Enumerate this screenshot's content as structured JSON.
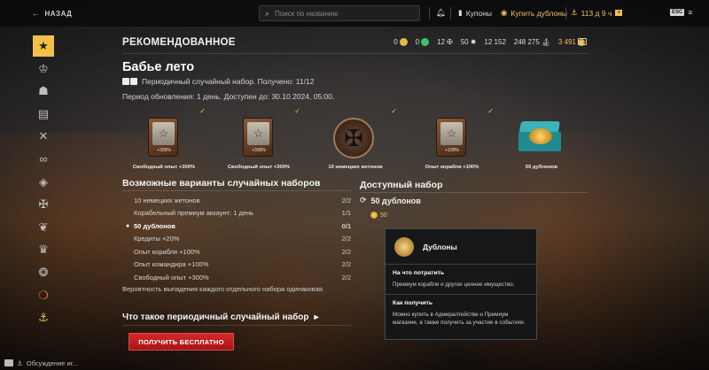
{
  "topbar": {
    "back_label": "НАЗАД",
    "search_placeholder": "Поиск по названию",
    "coupons_label": "Купоны",
    "buy_gold_label": "Купить дублоны",
    "premium_time": "113 д 9 ч",
    "esc_label": "ESC"
  },
  "sidebar": {
    "items": [
      "featured",
      "clan",
      "commander",
      "camouflage",
      "tools",
      "signals",
      "flags",
      "ensign",
      "eagle",
      "emblem",
      "medal",
      "chest",
      "anchor"
    ]
  },
  "header": {
    "title": "РЕКОМЕНДОВАННОЕ",
    "currencies": [
      {
        "value": "0",
        "color": "#e8b64a"
      },
      {
        "value": "0",
        "color": "#39c36b"
      },
      {
        "value": "12",
        "color": "#cfcfcf"
      },
      {
        "value": "50",
        "color": "#d8d8d8"
      },
      {
        "value": "12 152",
        "color": "#d8d8d8"
      },
      {
        "value": "248 275",
        "color": "#d8d8d8"
      },
      {
        "value": "3 491",
        "color": "#f0c060"
      }
    ]
  },
  "bundle": {
    "title": "Бабье лето",
    "subtitle": "Периодичный случайный набор. Получено: 11/12",
    "period": "Период обновления: 1 день. Доступен до: 30.10.2024, 05:00."
  },
  "rewards": [
    {
      "label": "Свободный опыт +300%",
      "pct": "+300%",
      "kind": "card"
    },
    {
      "label": "Свободный опыт +300%",
      "pct": "+300%",
      "kind": "card"
    },
    {
      "label": "10 немецких жетонов",
      "pct": "",
      "kind": "medal"
    },
    {
      "label": "Опыт корабля +100%",
      "pct": "+100%",
      "kind": "card"
    },
    {
      "label": "50 дублонов",
      "pct": "",
      "kind": "chest"
    }
  ],
  "possible": {
    "title": "Возможные варианты случайных наборов",
    "rows": [
      {
        "label": "10 немецких жетонов",
        "count": "2/2"
      },
      {
        "label": "Корабельный премиум аккаунт: 1 день",
        "count": "1/1"
      },
      {
        "label": "50 дублонов",
        "count": "0/1"
      },
      {
        "label": "Кредиты +20%",
        "count": "2/2"
      },
      {
        "label": "Опыт корабля +100%",
        "count": "2/2"
      },
      {
        "label": "Опыт командира +100%",
        "count": "2/2"
      },
      {
        "label": "Свободный опыт +300%",
        "count": "2/2"
      }
    ],
    "probability_note": "Вероятность выпадения каждого отдельного набора одинаковая."
  },
  "what_is": {
    "title": "Что такое периодичный случайный набор"
  },
  "cta": {
    "label": "ПОЛУЧИТЬ БЕСПЛАТНО"
  },
  "available": {
    "title": "Доступный набор",
    "item": "50 дублонов",
    "sub_value": "50"
  },
  "tooltip": {
    "title": "Дублоны",
    "section1_title": "На что потратить",
    "section1_text": "Премиум корабли и другое ценное имущество.",
    "section2_title": "Как получить",
    "section2_text": "Можно купить в Адмиралтействе и Премиум магазине, а также получить за участие в событиях."
  },
  "chat": {
    "label": "Обсуждение иг..."
  }
}
